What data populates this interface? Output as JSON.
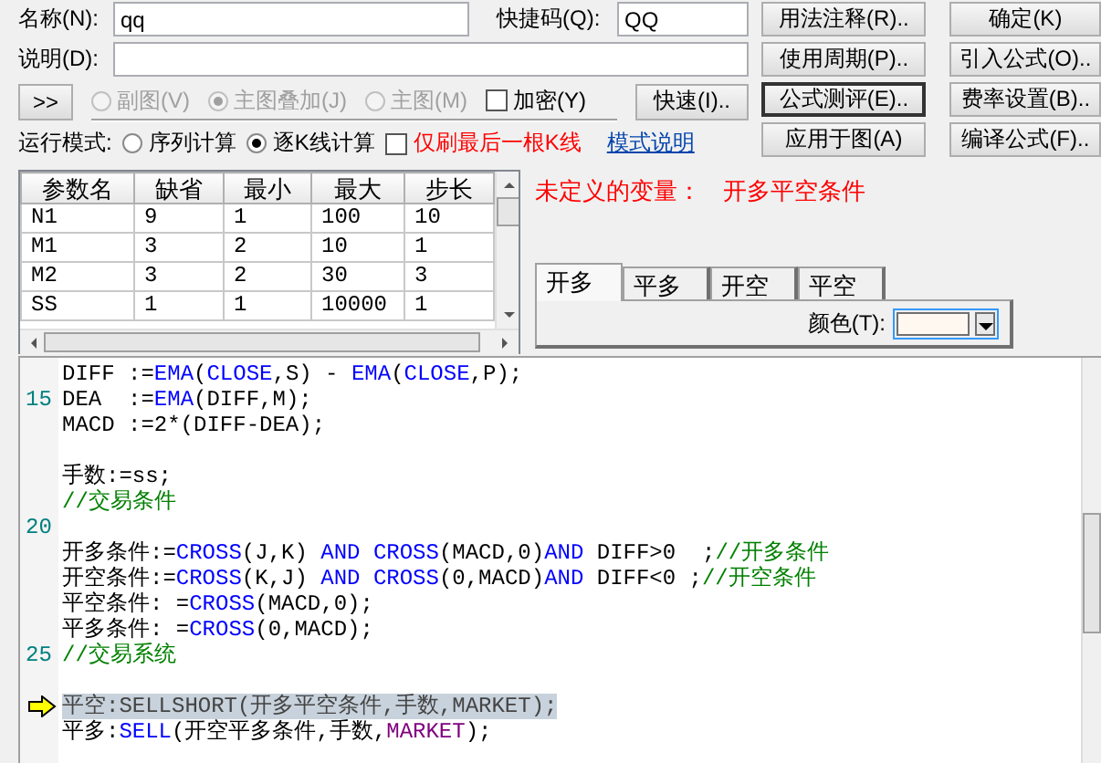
{
  "form": {
    "name_label": "名称(N):",
    "name_value": "qq",
    "hotkey_label": "快捷码(Q):",
    "hotkey_value": "QQ",
    "desc_label": "说明(D):",
    "expand_button": ">>",
    "chart_options": [
      {
        "label": "副图(V)",
        "selected": false,
        "disabled": true
      },
      {
        "label": "主图叠加(J)",
        "selected": true,
        "disabled": true
      },
      {
        "label": "主图(M)",
        "selected": false,
        "disabled": true
      }
    ],
    "encrypt": {
      "label": "加密(Y)",
      "checked": false
    },
    "fast_button": "快速(I)..",
    "run_mode_label": "运行模式:",
    "run_modes": [
      {
        "label": "序列计算",
        "selected": false
      },
      {
        "label": "逐K线计算",
        "selected": true
      }
    ],
    "refresh_last": {
      "label": "仅刷最后一根K线",
      "checked": false
    },
    "mode_help_link": "模式说明"
  },
  "buttons": [
    [
      {
        "label": "用法注释(R)..",
        "focused": false
      },
      {
        "label": "使用周期(P)..",
        "focused": false
      },
      {
        "label": "公式测评(E)..",
        "focused": true
      },
      {
        "label": "应用于图(A)",
        "focused": false
      }
    ],
    [
      {
        "label": "确定(K)",
        "focused": false
      },
      {
        "label": "引入公式(O)..",
        "focused": false
      },
      {
        "label": "费率设置(B)..",
        "focused": false
      },
      {
        "label": "编译公式(F)..",
        "focused": false
      }
    ]
  ],
  "params": {
    "columns": [
      "参数名",
      "缺省",
      "最小",
      "最大",
      "步长"
    ],
    "rows": [
      [
        "N1",
        "9",
        "1",
        "100",
        "10"
      ],
      [
        "M1",
        "3",
        "2",
        "10",
        "1"
      ],
      [
        "M2",
        "3",
        "2",
        "30",
        "3"
      ],
      [
        "SS",
        "1",
        "1",
        "10000",
        "1"
      ]
    ]
  },
  "error": {
    "label": "未定义的变量：",
    "value": "开多平空条件"
  },
  "tabs": [
    {
      "label": "开多",
      "selected": true
    },
    {
      "label": "平多",
      "selected": false
    },
    {
      "label": "开空",
      "selected": false
    },
    {
      "label": "平空",
      "selected": false
    }
  ],
  "color_label": "颜色(T):",
  "editor": {
    "lines": [
      {
        "kind": "code",
        "tokens": [
          {
            "kind": "plain",
            "text": "DIFF :="
          },
          {
            "kind": "func",
            "text": "EMA"
          },
          {
            "kind": "plain",
            "text": "("
          },
          {
            "kind": "func",
            "text": "CLOSE"
          },
          {
            "kind": "plain",
            "text": ",S) - "
          },
          {
            "kind": "func",
            "text": "EMA"
          },
          {
            "kind": "plain",
            "text": "("
          },
          {
            "kind": "func",
            "text": "CLOSE"
          },
          {
            "kind": "plain",
            "text": ",P);"
          }
        ]
      },
      {
        "kind": "code",
        "number": "15",
        "tokens": [
          {
            "kind": "plain",
            "text": "DEA  :="
          },
          {
            "kind": "func",
            "text": "EMA"
          },
          {
            "kind": "plain",
            "text": "(DIFF,M);"
          }
        ]
      },
      {
        "kind": "code",
        "tokens": [
          {
            "kind": "plain",
            "text": "MACD :=2*(DIFF-DEA);"
          }
        ]
      },
      {
        "kind": "blank"
      },
      {
        "kind": "code",
        "tokens": [
          {
            "kind": "plain",
            "text": "手数:=ss;"
          }
        ]
      },
      {
        "kind": "code",
        "tokens": [
          {
            "kind": "comment",
            "text": "//交易条件"
          }
        ]
      },
      {
        "kind": "blank",
        "number": "20"
      },
      {
        "kind": "code",
        "tokens": [
          {
            "kind": "plain",
            "text": "开多条件:="
          },
          {
            "kind": "func",
            "text": "CROSS"
          },
          {
            "kind": "plain",
            "text": "(J,K) "
          },
          {
            "kind": "func",
            "text": "AND CROSS"
          },
          {
            "kind": "plain",
            "text": "(MACD,0)"
          },
          {
            "kind": "func",
            "text": "AND"
          },
          {
            "kind": "plain",
            "text": " DIFF>0  ;"
          },
          {
            "kind": "comment",
            "text": "//开多条件"
          }
        ]
      },
      {
        "kind": "code",
        "tokens": [
          {
            "kind": "plain",
            "text": "开空条件:="
          },
          {
            "kind": "func",
            "text": "CROSS"
          },
          {
            "kind": "plain",
            "text": "(K,J) "
          },
          {
            "kind": "func",
            "text": "AND CROSS"
          },
          {
            "kind": "plain",
            "text": "(0,MACD)"
          },
          {
            "kind": "func",
            "text": "AND"
          },
          {
            "kind": "plain",
            "text": " DIFF<0 ;"
          },
          {
            "kind": "comment",
            "text": "//开空条件"
          }
        ]
      },
      {
        "kind": "code",
        "tokens": [
          {
            "kind": "plain",
            "text": "平空条件: ="
          },
          {
            "kind": "func",
            "text": "CROSS"
          },
          {
            "kind": "plain",
            "text": "(MACD,0);"
          }
        ]
      },
      {
        "kind": "code",
        "tokens": [
          {
            "kind": "plain",
            "text": "平多条件: ="
          },
          {
            "kind": "func",
            "text": "CROSS"
          },
          {
            "kind": "plain",
            "text": "(0,MACD);"
          }
        ]
      },
      {
        "kind": "code",
        "number": "25",
        "tokens": [
          {
            "kind": "comment",
            "text": "//交易系统"
          }
        ]
      },
      {
        "kind": "blank"
      },
      {
        "kind": "code",
        "current": true,
        "tokens": [
          {
            "kind": "plain",
            "text": "平空:SELLSHORT(开多平空条件,手数,MARKET);"
          }
        ]
      },
      {
        "kind": "code",
        "tokens": [
          {
            "kind": "plain",
            "text": "平多:"
          },
          {
            "kind": "func",
            "text": "SELL"
          },
          {
            "kind": "plain",
            "text": "(开空平多条件,手数,"
          },
          {
            "kind": "const",
            "text": "MARKET"
          },
          {
            "kind": "plain",
            "text": ");"
          }
        ]
      }
    ]
  }
}
